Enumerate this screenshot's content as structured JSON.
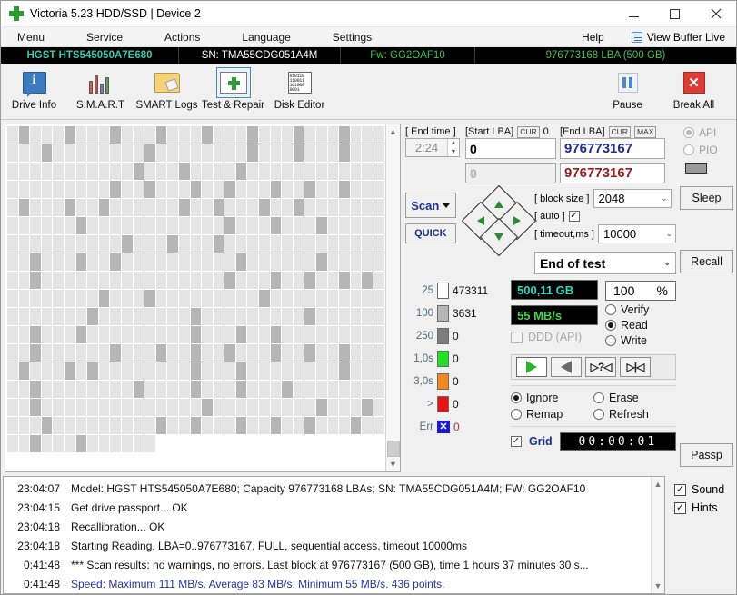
{
  "window": {
    "title": "Victoria 5.23 HDD/SSD | Device 2",
    "app_icon": "green-cross-icon",
    "minimize": "minimize-icon",
    "maximize": "maximize-icon",
    "close": "close-icon"
  },
  "menu": {
    "items": [
      "Menu",
      "Service",
      "Actions",
      "Language",
      "Settings"
    ],
    "help": "Help",
    "view_buffer_live": "View Buffer Live"
  },
  "drive_bar": {
    "model": "HGST HTS545050A7E680",
    "serial": "SN: TMA55CDG051A4M",
    "firmware": "Fw: GG2OAF10",
    "capacity": "976773168 LBA (500 GB)",
    "colors": {
      "model": "#39c9b0",
      "firmware": "#3fc45a",
      "capacity": "#46c34a"
    }
  },
  "toolbar": {
    "buttons": [
      {
        "label": "Drive Info",
        "icon": "drive-info-icon",
        "selected": false
      },
      {
        "label": "S.M.A.R.T",
        "icon": "smart-icon",
        "selected": false
      },
      {
        "label": "SMART Logs",
        "icon": "smart-logs-icon",
        "selected": false
      },
      {
        "label": "Test & Repair",
        "icon": "test-repair-icon",
        "selected": true
      },
      {
        "label": "Disk Editor",
        "icon": "disk-editor-icon",
        "selected": false
      }
    ],
    "right_buttons": [
      {
        "label": "Pause",
        "icon": "pause-icon"
      },
      {
        "label": "Break All",
        "icon": "break-all-icon"
      }
    ]
  },
  "scan_controls": {
    "end_time_label": "[ End time ]",
    "end_time_value": "2:24",
    "start_lba_label": "[Start LBA]",
    "start_lba_cur": "CUR",
    "start_lba_min": "0",
    "start_lba_value": "0",
    "start_lba_second": "0",
    "end_lba_label": "[End LBA]",
    "end_lba_cur": "CUR",
    "end_lba_max": "MAX",
    "end_lba_value": "976773167",
    "end_lba_second": "976773167",
    "scan_button": "Scan",
    "quick_button": "QUICK",
    "block_size_label": "[ block size ]",
    "block_size_value": "2048",
    "auto_label": "[ auto ]",
    "auto_checked": "✓",
    "timeout_label": "[ timeout,ms ]",
    "timeout_value": "10000",
    "end_of_test": "End of test",
    "dpad": [
      "up-arrow-icon",
      "down-arrow-icon",
      "left-arrow-icon",
      "right-arrow-icon"
    ]
  },
  "stats": {
    "rows": [
      {
        "time": "25",
        "color": "#ffffff",
        "count": "473311"
      },
      {
        "time": "100",
        "color": "#b6b6b6",
        "count": "3631"
      },
      {
        "time": "250",
        "color": "#7d7d7d",
        "count": "0"
      },
      {
        "time": "1,0s",
        "color": "#22e022",
        "count": "0"
      },
      {
        "time": "3,0s",
        "color": "#f08a1e",
        "count": "0"
      },
      {
        "time": ">",
        "color": "#e81414",
        "count": "0"
      },
      {
        "time": "Err",
        "color": "#1a1ad0",
        "count": "0",
        "is_error": true
      }
    ]
  },
  "readout": {
    "capacity": "500,11 GB",
    "speed": "55 MB/s",
    "percent_value": "100",
    "percent_sign": "%",
    "ddd_label": "DDD (API)",
    "modes": [
      {
        "label": "Verify",
        "selected": false
      },
      {
        "label": "Read",
        "selected": true
      },
      {
        "label": "Write",
        "selected": false
      }
    ],
    "nav_buttons": [
      "play-forward-icon",
      "play-backward-icon",
      "seek-question-icon",
      "seek-end-icon"
    ],
    "actions": [
      {
        "label": "Ignore",
        "selected": true
      },
      {
        "label": "Erase",
        "selected": false
      },
      {
        "label": "Remap",
        "selected": false
      },
      {
        "label": "Refresh",
        "selected": false
      }
    ],
    "grid_label": "Grid",
    "grid_checked": "✓",
    "timer": "00:00:01"
  },
  "rail": {
    "api_label": "API",
    "api_selected": true,
    "pio_label": "PIO",
    "pio_selected": false,
    "buttons": [
      "Sleep",
      "Recall",
      "Passp"
    ]
  },
  "log": {
    "entries": [
      {
        "time": "23:04:07",
        "message": "Model: HGST HTS545050A7E680; Capacity 976773168 LBAs; SN: TMA55CDG051A4M; FW: GG2OAF10",
        "blue": false
      },
      {
        "time": "23:04:15",
        "message": "Get drive passport... OK",
        "blue": false
      },
      {
        "time": "23:04:18",
        "message": "Recallibration... OK",
        "blue": false
      },
      {
        "time": "23:04:18",
        "message": "Starting Reading, LBA=0..976773167, FULL, sequential access, timeout 10000ms",
        "blue": false
      },
      {
        "time": "0:41:48",
        "message": "*** Scan results: no warnings, no errors. Last block at 976773167 (500 GB), time 1 hours 37 minutes 30 s...",
        "blue": false
      },
      {
        "time": "0:41:48",
        "message": "Speed: Maximum 111 MB/s. Average 83 MB/s. Minimum 55 MB/s. 436 points.",
        "blue": true
      }
    ],
    "options": [
      {
        "label": "Sound",
        "checked": true
      },
      {
        "label": "Hints",
        "checked": true
      }
    ]
  },
  "map": {
    "columns": 34,
    "rows": 18,
    "last_row_filled": 13,
    "gray_cells": [
      [
        0,
        1
      ],
      [
        0,
        5
      ],
      [
        0,
        9
      ],
      [
        0,
        13
      ],
      [
        0,
        17
      ],
      [
        0,
        21
      ],
      [
        0,
        25
      ],
      [
        0,
        29
      ],
      [
        1,
        3
      ],
      [
        1,
        12
      ],
      [
        1,
        21
      ],
      [
        1,
        25
      ],
      [
        1,
        29
      ],
      [
        2,
        11
      ],
      [
        2,
        15
      ],
      [
        2,
        20
      ],
      [
        3,
        9
      ],
      [
        3,
        12
      ],
      [
        3,
        16
      ],
      [
        3,
        19
      ],
      [
        3,
        23
      ],
      [
        3,
        26
      ],
      [
        3,
        29
      ],
      [
        4,
        1
      ],
      [
        4,
        5
      ],
      [
        4,
        8
      ],
      [
        4,
        15
      ],
      [
        4,
        18
      ],
      [
        4,
        22
      ],
      [
        4,
        25
      ],
      [
        5,
        6
      ],
      [
        5,
        19
      ],
      [
        5,
        23
      ],
      [
        5,
        27
      ],
      [
        6,
        10
      ],
      [
        6,
        14
      ],
      [
        6,
        18
      ],
      [
        7,
        2
      ],
      [
        7,
        6
      ],
      [
        7,
        9
      ],
      [
        7,
        20
      ],
      [
        7,
        27
      ],
      [
        8,
        2
      ],
      [
        8,
        19
      ],
      [
        8,
        23
      ],
      [
        8,
        26
      ],
      [
        8,
        29
      ],
      [
        8,
        31
      ],
      [
        9,
        8
      ],
      [
        9,
        12
      ],
      [
        9,
        22
      ],
      [
        10,
        7
      ],
      [
        10,
        16
      ],
      [
        10,
        26
      ],
      [
        11,
        2
      ],
      [
        11,
        6
      ],
      [
        11,
        16
      ],
      [
        11,
        20
      ],
      [
        11,
        23
      ],
      [
        12,
        2
      ],
      [
        12,
        9
      ],
      [
        12,
        13
      ],
      [
        12,
        16
      ],
      [
        12,
        19
      ],
      [
        12,
        23
      ],
      [
        12,
        26
      ],
      [
        12,
        29
      ],
      [
        13,
        1
      ],
      [
        13,
        5
      ],
      [
        13,
        7
      ],
      [
        13,
        16
      ],
      [
        13,
        20
      ],
      [
        13,
        29
      ],
      [
        14,
        2
      ],
      [
        14,
        11
      ],
      [
        14,
        16
      ],
      [
        14,
        20
      ],
      [
        14,
        24
      ],
      [
        15,
        2
      ],
      [
        15,
        17
      ],
      [
        15,
        27
      ],
      [
        15,
        31
      ],
      [
        16,
        3
      ],
      [
        16,
        13
      ],
      [
        16,
        16
      ],
      [
        16,
        20
      ],
      [
        16,
        23
      ],
      [
        16,
        26
      ],
      [
        16,
        30
      ],
      [
        17,
        2
      ],
      [
        17,
        6
      ]
    ]
  }
}
